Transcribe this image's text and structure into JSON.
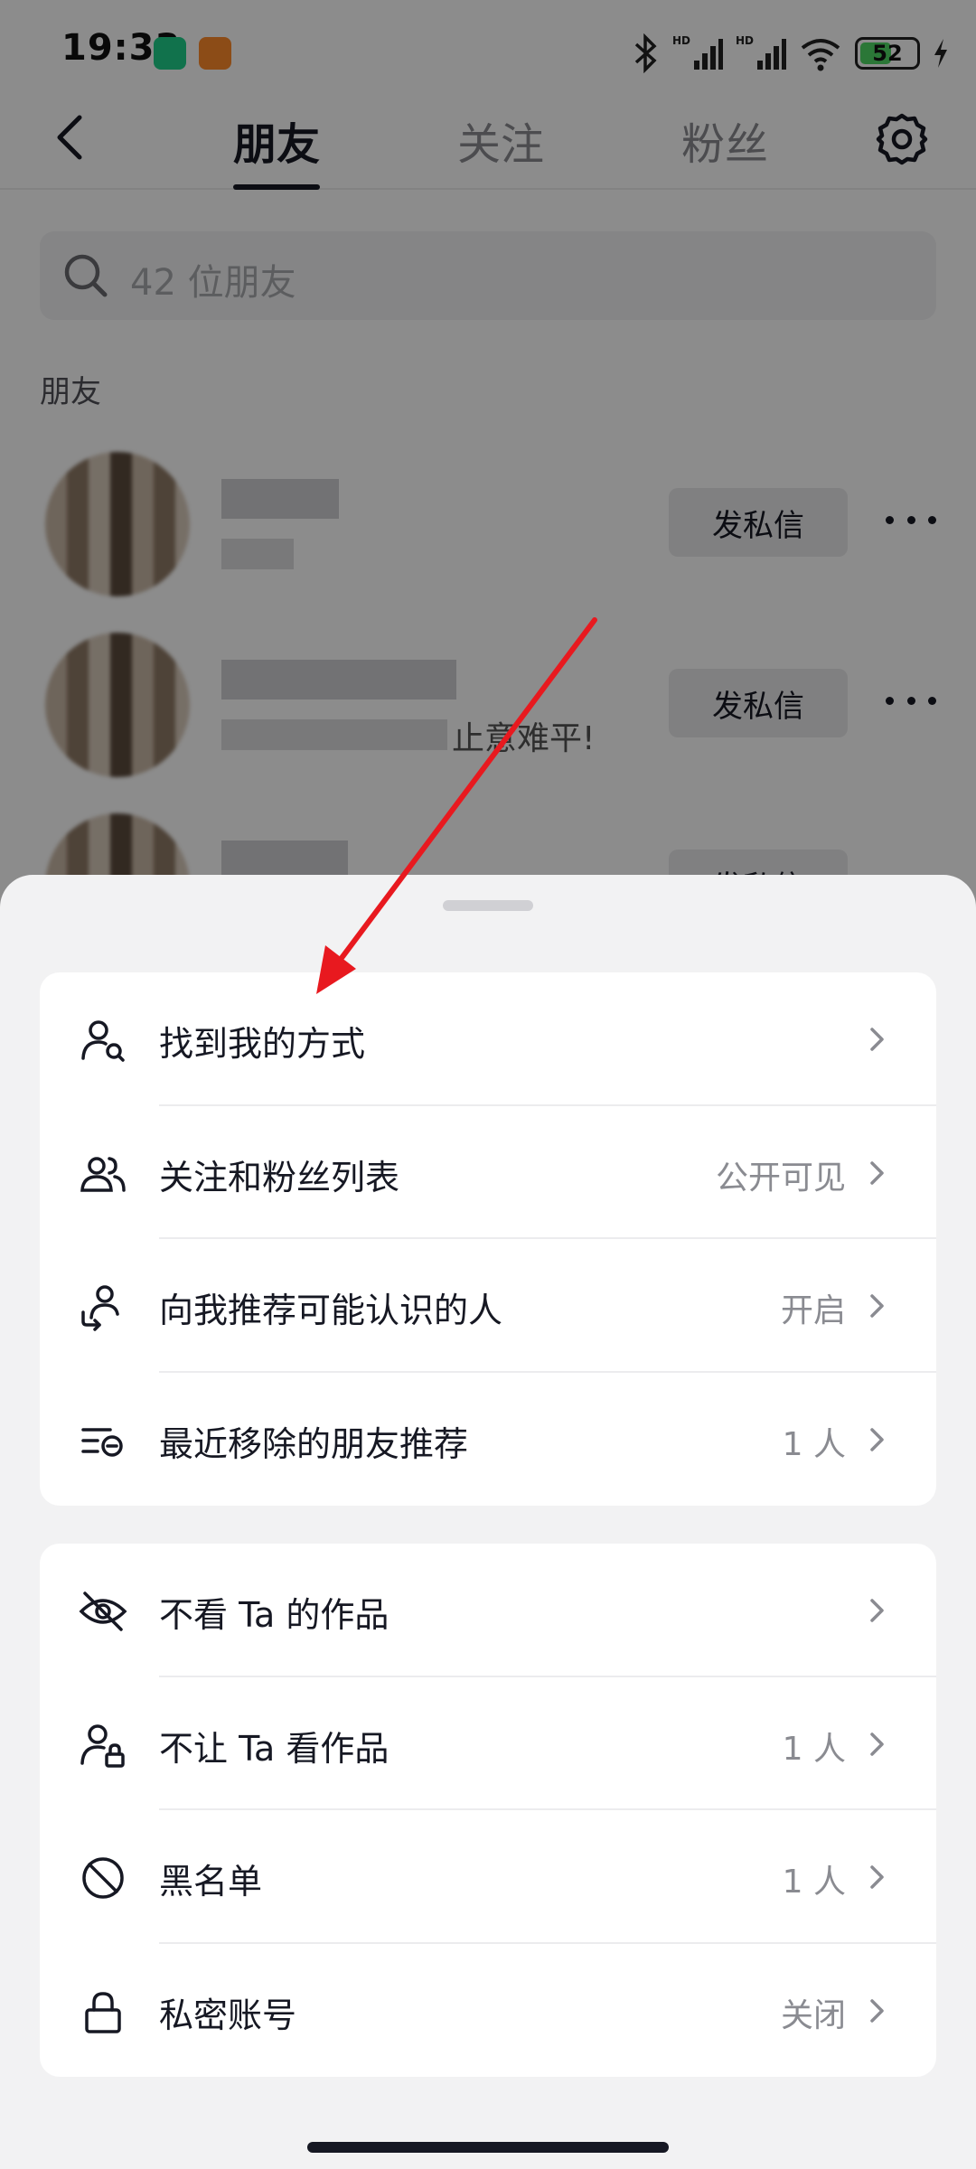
{
  "status_bar": {
    "time": "19:33",
    "battery": "52"
  },
  "nav": {
    "tabs": [
      {
        "label": "朋友",
        "active": true
      },
      {
        "label": "关注",
        "active": false
      },
      {
        "label": "粉丝",
        "active": false
      }
    ]
  },
  "search": {
    "placeholder": "42 位朋友"
  },
  "friends_section": {
    "label": "朋友",
    "rows": [
      {
        "dm_label": "发私信",
        "sub_text": ""
      },
      {
        "dm_label": "发私信",
        "sub_text": "止意难平!"
      },
      {
        "dm_label": "发私信",
        "sub_text": ""
      }
    ]
  },
  "sheet": {
    "group1": [
      {
        "icon": "find-me-icon",
        "label": "找到我的方式",
        "value": ""
      },
      {
        "icon": "users-icon",
        "label": "关注和粉丝列表",
        "value": "公开可见"
      },
      {
        "icon": "recommend-icon",
        "label": "向我推荐可能认识的人",
        "value": "开启"
      },
      {
        "icon": "removed-list-icon",
        "label": "最近移除的朋友推荐",
        "value": "1 人"
      }
    ],
    "group2": [
      {
        "icon": "eye-off-icon",
        "label": "不看 Ta 的作品",
        "value": ""
      },
      {
        "icon": "user-lock-icon",
        "label": "不让 Ta 看作品",
        "value": "1 人"
      },
      {
        "icon": "block-icon",
        "label": "黑名单",
        "value": "1 人"
      },
      {
        "icon": "lock-icon",
        "label": "私密账号",
        "value": "关闭"
      }
    ]
  },
  "colors": {
    "annotation_arrow": "#e8191f",
    "text_primary": "#161823",
    "text_secondary": "#8a8b91"
  }
}
